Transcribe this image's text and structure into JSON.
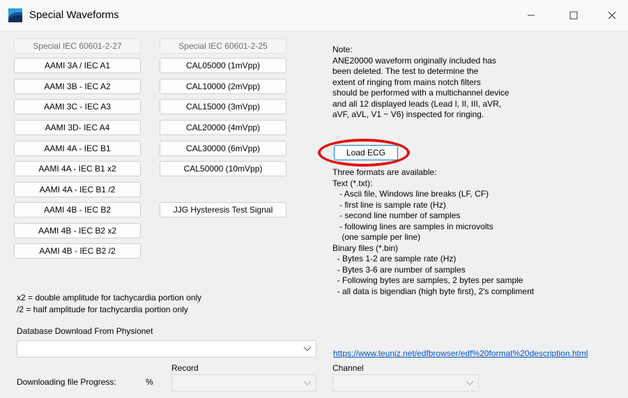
{
  "window": {
    "title": "Special Waveforms",
    "icon": "app-logo-icon",
    "controls": {
      "minimize": "minimize-icon",
      "maximize": "maximize-icon",
      "close": "close-icon"
    }
  },
  "left_column": {
    "header": "Special IEC 60601-2-27",
    "buttons": [
      "AAMI 3A / IEC A1",
      "AAMI 3B - IEC A2",
      "AAMI 3C - IEC A3",
      "AAMI 3D- IEC A4",
      "AAMI 4A - IEC B1",
      "AAMI 4A - IEC B1 x2",
      "AAMI 4A - IEC B1 /2",
      "AAMI 4B - IEC B2",
      "AAMI 4B - IEC B2 x2",
      "AAMI 4B - IEC B2 /2"
    ]
  },
  "middle_column": {
    "header": "Special IEC 60601-2-25",
    "buttons": [
      "CAL05000 (1mVpp)",
      "CAL10000 (2mVpp)",
      "CAL15000 (3mVpp)",
      "CAL20000 (4mVpp)",
      "CAL30000 (6mVpp)",
      "CAL50000 (10mVpp)"
    ],
    "jjg_button": "JJG Hysteresis Test Signal"
  },
  "note": {
    "lines": [
      "Note:",
      "ANE20000 waveform originally included has",
      "been deleted. The test to determine the",
      "extent of ringing from mains notch filters",
      "should be performed with a multichannel device",
      "and all 12 displayed leads (Lead I, II, III, aVR,",
      "aVF, aVL, V1 ~ V6) inspected for ringing."
    ]
  },
  "load_ecg": {
    "label": "Load ECG",
    "highlight_color": "#e01010"
  },
  "formats": {
    "lines": [
      "Three formats are available:",
      "Text (*.txt):",
      "   - Ascii file, Windows line breaks (LF, CF)",
      "   - first line is sample rate (Hz)",
      "   - second line number of samples",
      "   - following lines are samples in microvolts",
      "    (one sample per line)",
      "Binary files (*.bin)",
      "  - Bytes 1-2 are sample rate (Hz)",
      "  - Bytes 3-6 are number of samples",
      "  - Following bytes are samples, 2 bytes per sample",
      "  - all data is bigendian (high byte first), 2's compliment"
    ]
  },
  "legend": {
    "x2": "x2 = double amplitude for tachycardia portion only",
    "half": "/2 = half amplitude for tachycardia portion only"
  },
  "database": {
    "label": "Database Download From Physionet",
    "selected": ""
  },
  "link": "https://www.teuniz.net/edfbrowser/edf%20format%20description.html",
  "record": {
    "label": "Record",
    "value": ""
  },
  "channel": {
    "label": "Channel",
    "value": ""
  },
  "progress": {
    "label": "Downloading file Progress:",
    "unit": "%"
  }
}
